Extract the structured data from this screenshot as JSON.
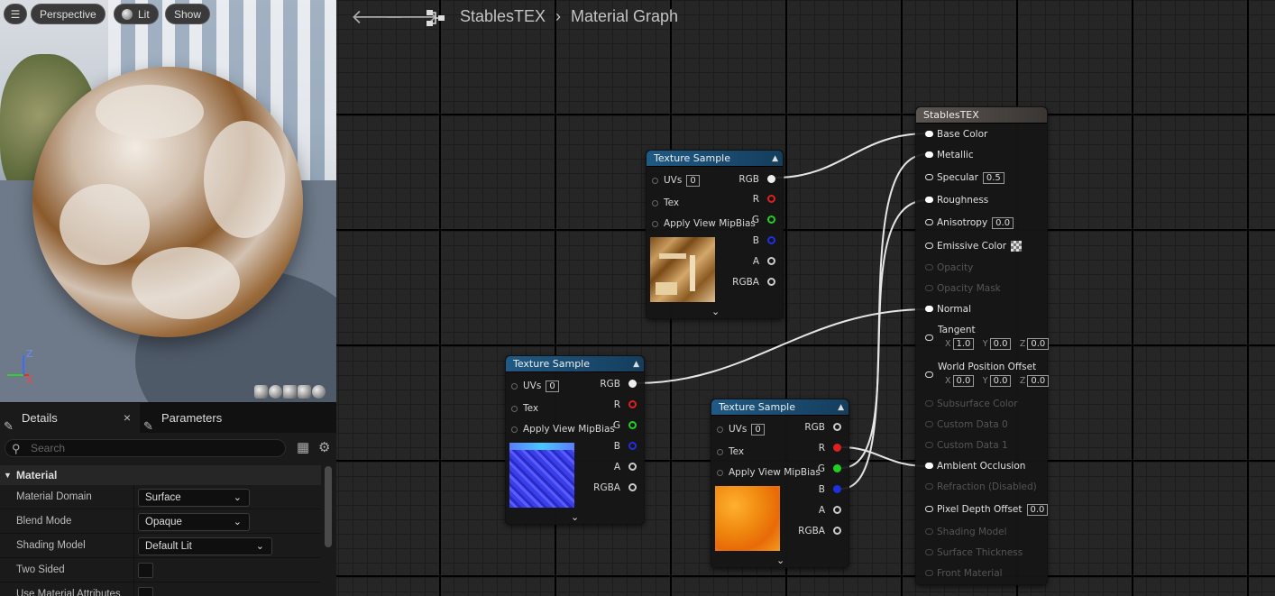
{
  "viewport": {
    "menu_icon": "hamburger-icon",
    "perspective_label": "Perspective",
    "lit_label": "Lit",
    "show_label": "Show",
    "axis_z": "Z",
    "axis_x": "X"
  },
  "details": {
    "tab_details": "Details",
    "tab_parameters": "Parameters",
    "search_placeholder": "Search",
    "category": "Material",
    "props": [
      {
        "label": "Material Domain",
        "value": "Surface"
      },
      {
        "label": "Blend Mode",
        "value": "Opaque"
      },
      {
        "label": "Shading Model",
        "value": "Default Lit"
      },
      {
        "label": "Two Sided",
        "value": ""
      },
      {
        "label": "Use Material Attributes",
        "value": ""
      }
    ]
  },
  "graph": {
    "breadcrumb_asset": "StablesTEX",
    "breadcrumb_sep": "›",
    "breadcrumb_page": "Material Graph",
    "texture_sample_title": "Texture Sample",
    "inputs": {
      "uvs": "UVs",
      "uvs_val": "0",
      "tex": "Tex",
      "mip": "Apply View MipBias"
    },
    "outputs": {
      "rgb": "RGB",
      "r": "R",
      "g": "G",
      "b": "B",
      "a": "A",
      "rgba": "RGBA"
    },
    "result_title": "StablesTEX",
    "result_pins": {
      "base_color": "Base Color",
      "metallic": "Metallic",
      "specular": "Specular",
      "specular_val": "0.5",
      "roughness": "Roughness",
      "anisotropy": "Anisotropy",
      "anisotropy_val": "0.0",
      "emissive": "Emissive Color",
      "opacity": "Opacity",
      "opacity_mask": "Opacity Mask",
      "normal": "Normal",
      "tangent": "Tangent",
      "wpo": "World Position Offset",
      "subsurface": "Subsurface Color",
      "custom0": "Custom Data 0",
      "custom1": "Custom Data 1",
      "ao": "Ambient Occlusion",
      "refraction": "Refraction (Disabled)",
      "pdo": "Pixel Depth Offset",
      "pdo_val": "0.0",
      "shading_model": "Shading Model",
      "surface_thickness": "Surface Thickness",
      "front_material": "Front Material",
      "vec_x": "X",
      "vec_y": "Y",
      "vec_z": "Z",
      "tangent_x": "1.0",
      "tangent_y": "0.0",
      "tangent_z": "0.0",
      "wpo_x": "0.0",
      "wpo_y": "0.0",
      "wpo_z": "0.0"
    }
  },
  "colors": {
    "pin_r": "#e02020",
    "pin_g": "#20d020",
    "pin_b": "#2030e0",
    "node_header": "#1f5a85",
    "result_header": "#5a5551"
  }
}
